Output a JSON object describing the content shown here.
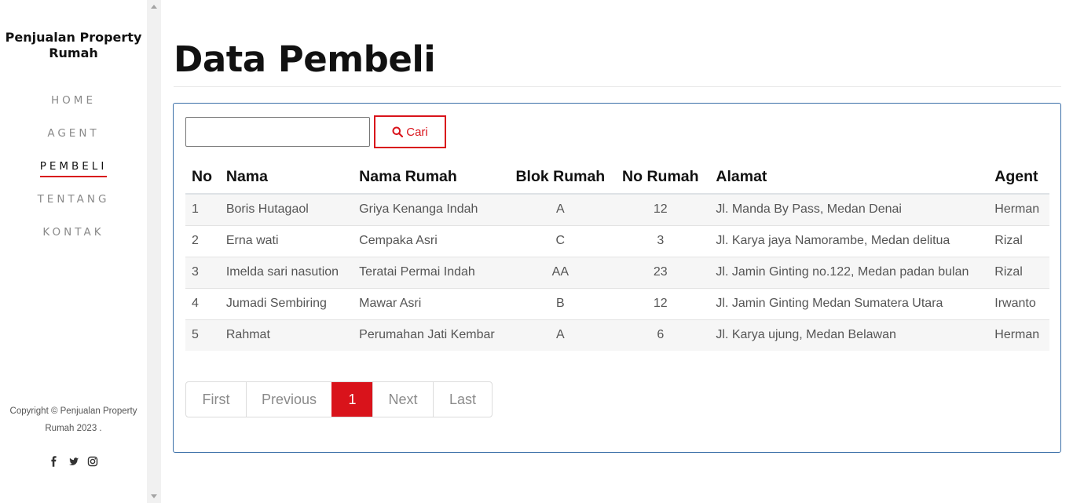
{
  "sidebar": {
    "brand": "Penjualan Property Rumah",
    "nav": [
      {
        "label": "HOME",
        "active": false
      },
      {
        "label": "AGENT",
        "active": false
      },
      {
        "label": "PEMBELI",
        "active": true
      },
      {
        "label": "TENTANG",
        "active": false
      },
      {
        "label": "KONTAK",
        "active": false
      }
    ],
    "copyright": "Copyright © Penjualan Property Rumah 2023 .",
    "socials": [
      "facebook-icon",
      "twitter-icon",
      "instagram-icon"
    ]
  },
  "main": {
    "title": "Data Pembeli",
    "search": {
      "value": "",
      "placeholder": "",
      "button_label": "Cari",
      "button_icon": "search-icon"
    },
    "table": {
      "columns": [
        "No",
        "Nama",
        "Nama Rumah",
        "Blok Rumah",
        "No Rumah",
        "Alamat",
        "Agent"
      ],
      "rows": [
        [
          "1",
          "Boris Hutagaol",
          "Griya Kenanga Indah",
          "A",
          "12",
          "Jl. Manda By Pass, Medan Denai",
          "Herman"
        ],
        [
          "2",
          "Erna wati",
          "Cempaka Asri",
          "C",
          "3",
          "Jl. Karya jaya Namorambe, Medan delitua",
          "Rizal"
        ],
        [
          "3",
          "Imelda sari nasution",
          "Teratai Permai Indah",
          "AA",
          "23",
          "Jl. Jamin Ginting no.122, Medan padan bulan",
          "Rizal"
        ],
        [
          "4",
          "Jumadi Sembiring",
          "Mawar Asri",
          "B",
          "12",
          "Jl. Jamin Ginting Medan Sumatera Utara",
          "Irwanto"
        ],
        [
          "5",
          "Rahmat",
          "Perumahan Jati Kembar",
          "A",
          "6",
          "Jl. Karya ujung, Medan Belawan",
          "Herman"
        ]
      ]
    },
    "pagination": {
      "items": [
        {
          "label": "First",
          "active": false
        },
        {
          "label": "Previous",
          "active": false
        },
        {
          "label": "1",
          "active": true
        },
        {
          "label": "Next",
          "active": false
        },
        {
          "label": "Last",
          "active": false
        }
      ]
    }
  },
  "colors": {
    "accent": "#d9131b",
    "panel_border": "#3b6fa8"
  }
}
